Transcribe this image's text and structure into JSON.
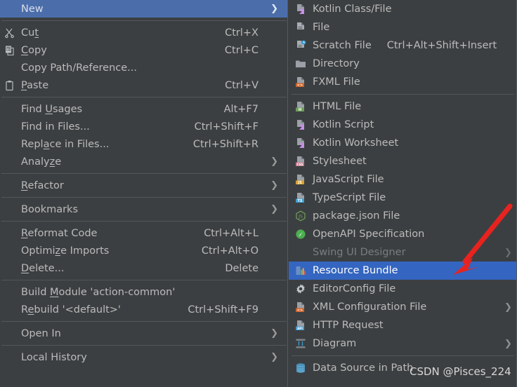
{
  "colors": {
    "menu_background": "#3C3F41",
    "text": "#BBBBBB",
    "disabled_text": "#7A7D7F",
    "separator": "#53575A",
    "left_selection": "#4B6EAB",
    "right_selection": "#3465C0",
    "annotation_arrow": "#E8231F",
    "kotlin_badge": "#C88FE8",
    "html_badge": "#6FA05A",
    "css_badge": "#C47C8E",
    "js_badge": "#D9A22B",
    "ts_badge": "#3C9FD4",
    "xml_badge": "#D1642A",
    "api_badge": "#4A9BD1"
  },
  "context_menu": {
    "name": "editor-context-menu",
    "groups": [
      {
        "items": [
          {
            "label": "New",
            "icon": "none",
            "accel": "",
            "arrow": true,
            "selected": true,
            "mnemonic": ""
          }
        ]
      },
      {
        "items": [
          {
            "label": "Cut",
            "icon": "cut-icon",
            "accel": "Ctrl+X",
            "arrow": false,
            "mnemonic": "t"
          },
          {
            "label": "Copy",
            "icon": "copy-icon",
            "accel": "Ctrl+C",
            "arrow": false,
            "mnemonic": "C"
          },
          {
            "label": "Copy Path/Reference...",
            "icon": "none",
            "accel": "",
            "arrow": false,
            "mnemonic": ""
          },
          {
            "label": "Paste",
            "icon": "paste-icon",
            "accel": "Ctrl+V",
            "arrow": false,
            "mnemonic": "P"
          }
        ]
      },
      {
        "items": [
          {
            "label": "Find Usages",
            "icon": "none",
            "accel": "Alt+F7",
            "arrow": false,
            "mnemonic": "U"
          },
          {
            "label": "Find in Files...",
            "icon": "none",
            "accel": "Ctrl+Shift+F",
            "arrow": false,
            "mnemonic": ""
          },
          {
            "label": "Replace in Files...",
            "icon": "none",
            "accel": "Ctrl+Shift+R",
            "arrow": false,
            "mnemonic": "a"
          },
          {
            "label": "Analyze",
            "icon": "none",
            "accel": "",
            "arrow": true,
            "mnemonic": "z"
          }
        ]
      },
      {
        "items": [
          {
            "label": "Refactor",
            "icon": "none",
            "accel": "",
            "arrow": true,
            "mnemonic": "R"
          }
        ]
      },
      {
        "items": [
          {
            "label": "Bookmarks",
            "icon": "none",
            "accel": "",
            "arrow": true,
            "mnemonic": ""
          }
        ]
      },
      {
        "items": [
          {
            "label": "Reformat Code",
            "icon": "none",
            "accel": "Ctrl+Alt+L",
            "arrow": false,
            "mnemonic": "R"
          },
          {
            "label": "Optimize Imports",
            "icon": "none",
            "accel": "Ctrl+Alt+O",
            "arrow": false,
            "mnemonic": "z"
          },
          {
            "label": "Delete...",
            "icon": "none",
            "accel": "Delete",
            "arrow": false,
            "mnemonic": "D"
          }
        ]
      },
      {
        "items": [
          {
            "label": "Build Module 'action-common'",
            "icon": "none",
            "accel": "",
            "arrow": false,
            "mnemonic": "M"
          },
          {
            "label": "Rebuild '<default>'",
            "icon": "none",
            "accel": "Ctrl+Shift+F9",
            "arrow": false,
            "mnemonic": "e"
          }
        ]
      },
      {
        "items": [
          {
            "label": "Open In",
            "icon": "none",
            "accel": "",
            "arrow": true,
            "mnemonic": ""
          }
        ]
      },
      {
        "items": [
          {
            "label": "Local History",
            "icon": "none",
            "accel": "",
            "arrow": true,
            "mnemonic": ""
          }
        ]
      }
    ]
  },
  "new_submenu": {
    "name": "new-submenu",
    "groups": [
      {
        "items": [
          {
            "label": "Kotlin Class/File",
            "icon": "kotlin-file-icon",
            "accel": "",
            "arrow": false,
            "disabled": false
          },
          {
            "label": "File",
            "icon": "file-icon",
            "accel": "",
            "arrow": false,
            "disabled": false
          },
          {
            "label": "Scratch File",
            "icon": "scratch-file-icon",
            "accel": "Ctrl+Alt+Shift+Insert",
            "arrow": false,
            "disabled": false
          },
          {
            "label": "Directory",
            "icon": "directory-icon",
            "accel": "",
            "arrow": false,
            "disabled": false
          },
          {
            "label": "FXML File",
            "icon": "fxml-file-icon",
            "accel": "",
            "arrow": false,
            "disabled": false
          }
        ]
      },
      {
        "items": [
          {
            "label": "HTML File",
            "icon": "html-file-icon",
            "accel": "",
            "arrow": false,
            "disabled": false
          },
          {
            "label": "Kotlin Script",
            "icon": "kotlin-script-icon",
            "accel": "",
            "arrow": false,
            "disabled": false
          },
          {
            "label": "Kotlin Worksheet",
            "icon": "kotlin-worksheet-icon",
            "accel": "",
            "arrow": false,
            "disabled": false
          },
          {
            "label": "Stylesheet",
            "icon": "css-file-icon",
            "accel": "",
            "arrow": false,
            "disabled": false
          },
          {
            "label": "JavaScript File",
            "icon": "js-file-icon",
            "accel": "",
            "arrow": false,
            "disabled": false
          },
          {
            "label": "TypeScript File",
            "icon": "ts-file-icon",
            "accel": "",
            "arrow": false,
            "disabled": false
          },
          {
            "label": "package.json File",
            "icon": "nodejs-icon",
            "accel": "",
            "arrow": false,
            "disabled": false
          },
          {
            "label": "OpenAPI Specification",
            "icon": "openapi-icon",
            "accel": "",
            "arrow": false,
            "disabled": false
          },
          {
            "label": "Swing UI Designer",
            "icon": "none",
            "accel": "",
            "arrow": true,
            "disabled": true
          },
          {
            "label": "Resource Bundle",
            "icon": "resource-bundle-icon",
            "accel": "",
            "arrow": false,
            "disabled": false,
            "selected": true
          },
          {
            "label": "EditorConfig File",
            "icon": "gear-icon",
            "accel": "",
            "arrow": false,
            "disabled": false
          },
          {
            "label": "XML Configuration File",
            "icon": "xml-file-icon",
            "accel": "",
            "arrow": true,
            "disabled": false
          },
          {
            "label": "HTTP Request",
            "icon": "http-request-icon",
            "accel": "",
            "arrow": false,
            "disabled": false
          },
          {
            "label": "Diagram",
            "icon": "diagram-icon",
            "accel": "",
            "arrow": true,
            "disabled": false
          }
        ]
      },
      {
        "items": [
          {
            "label": "Data Source in Path",
            "icon": "data-source-icon",
            "accel": "",
            "arrow": false,
            "disabled": false
          }
        ]
      }
    ]
  },
  "annotation": {
    "name": "red-arrow-annotation",
    "points_to": "Resource Bundle",
    "color": "#E8231F"
  },
  "watermark": {
    "text": "CSDN @Pisces_224"
  }
}
